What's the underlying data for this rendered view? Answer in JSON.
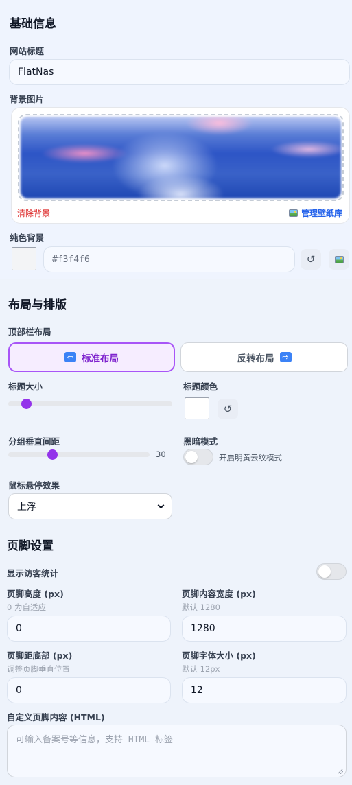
{
  "basic": {
    "title": "基础信息",
    "site_title_label": "网站标题",
    "site_title_value": "FlatNas",
    "bg_image_label": "背景图片",
    "clear_bg": "清除背景",
    "manage_wallpaper": "管理壁纸库",
    "solid_bg_label": "纯色背景",
    "solid_bg_value": "#f3f4f6",
    "reset_icon": "↺"
  },
  "layout": {
    "title": "布局与排版",
    "topbar_label": "顶部栏布局",
    "standard_layout": "标准布局",
    "reverse_layout": "反转布局",
    "title_size_label": "标题大小",
    "title_size_level": 0.08,
    "title_color_label": "标题颜色",
    "title_color_value": "#ffffff",
    "group_gap_label": "分组垂直间距",
    "group_gap_value": "30",
    "group_gap_level": 0.31,
    "dark_mode_label": "黑暗模式",
    "dark_mode_toggle_text": "开启明黄云纹模式",
    "dark_mode_on": false,
    "hover_label": "鼠标悬停效果",
    "hover_value": "上浮"
  },
  "footer": {
    "title": "页脚设置",
    "show_visitors_label": "显示访客统计",
    "show_visitors_on": false,
    "height_label": "页脚高度 (px)",
    "height_hint": "0 为自适应",
    "height_value": "0",
    "width_label": "页脚内容宽度 (px)",
    "width_hint": "默认 1280",
    "width_value": "1280",
    "bottom_label": "页脚距底部 (px)",
    "bottom_hint": "调整页脚垂直位置",
    "bottom_value": "0",
    "font_label": "页脚字体大小 (px)",
    "font_hint": "默认 12px",
    "font_value": "12",
    "custom_label": "自定义页脚内容 (HTML)",
    "custom_placeholder": "可输入备案号等信息，支持 HTML 标签"
  },
  "colors": {
    "accent": "#9333ea",
    "danger": "#dc2626",
    "link": "#2563eb"
  },
  "icons": [
    "reset-icon",
    "picture-icon",
    "arrow-left-icon",
    "arrow-right-icon",
    "chevron-down-icon"
  ]
}
